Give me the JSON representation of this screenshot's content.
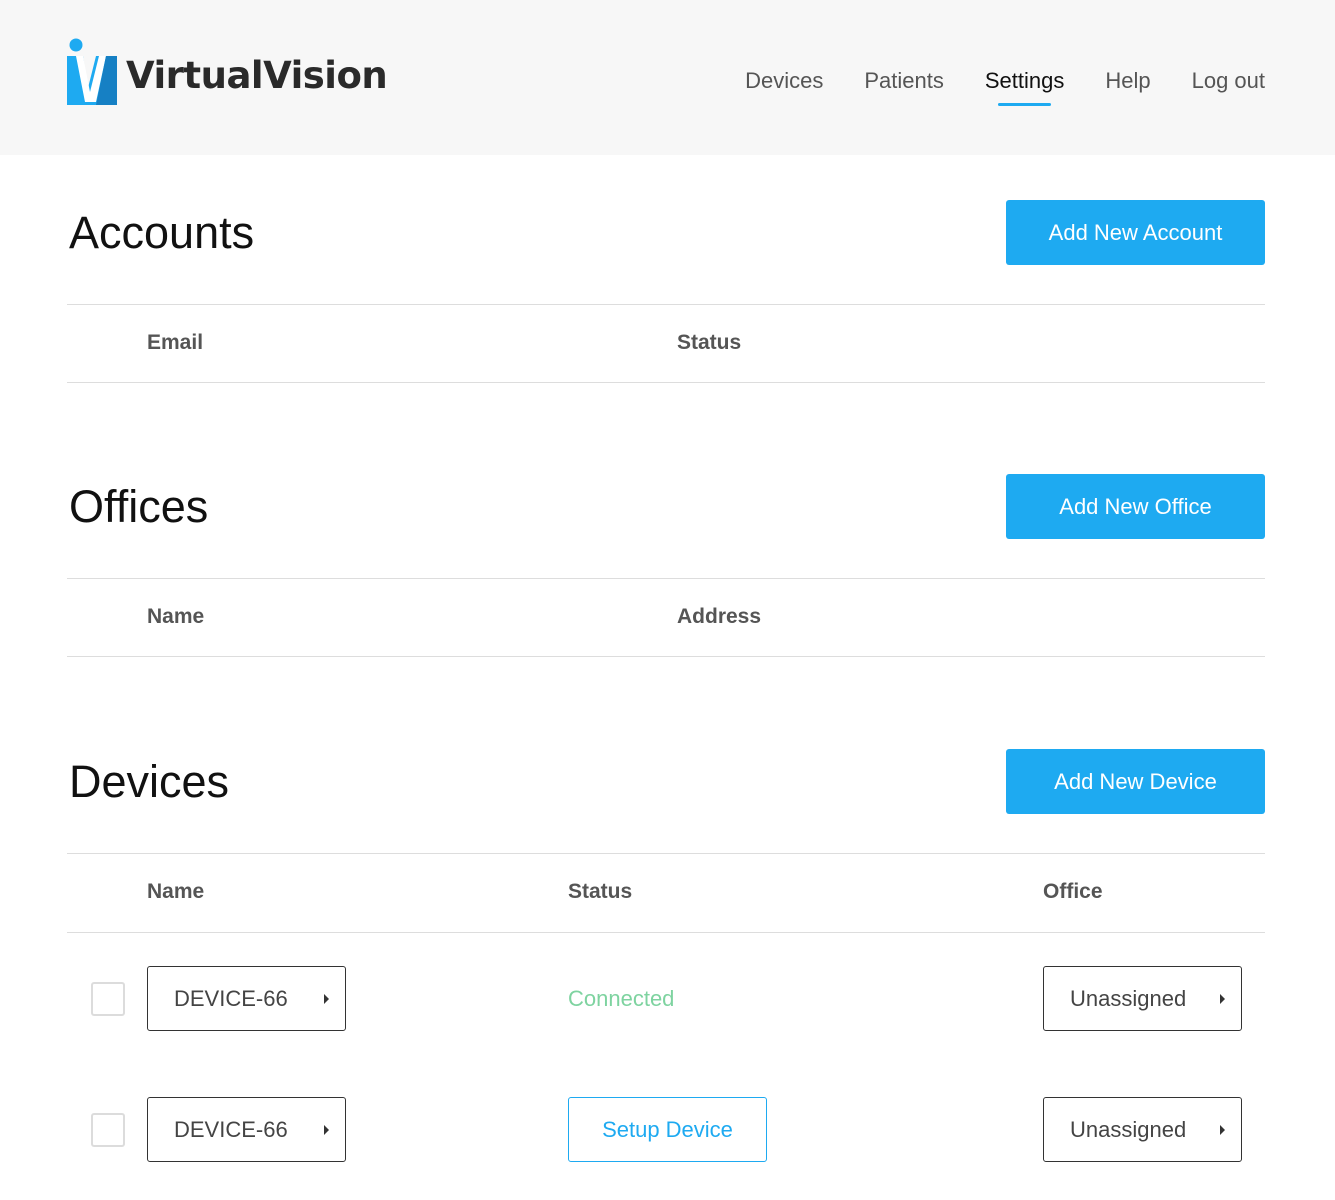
{
  "brand": {
    "name": "VirtualVision",
    "accent": "#1eaaf1"
  },
  "nav": [
    {
      "label": "Devices",
      "active": false
    },
    {
      "label": "Patients",
      "active": false
    },
    {
      "label": "Settings",
      "active": true
    },
    {
      "label": "Help",
      "active": false
    },
    {
      "label": "Log out",
      "active": false
    }
  ],
  "accounts": {
    "title": "Accounts",
    "add_label": "Add New Account",
    "columns": [
      "Email",
      "Status"
    ]
  },
  "offices": {
    "title": "Offices",
    "add_label": "Add New Office",
    "columns": [
      "Name",
      "Address"
    ]
  },
  "devices": {
    "title": "Devices",
    "add_label": "Add New Device",
    "columns": [
      "Name",
      "Status",
      "Office"
    ],
    "rows": [
      {
        "name": "DEVICE-66",
        "status": "Connected",
        "office": "Unassigned"
      },
      {
        "name": "DEVICE-66",
        "status_action": "Setup Device",
        "office": "Unassigned"
      }
    ]
  },
  "colors": {
    "connected": "#7ed3a0",
    "button": "#1eaaf1"
  }
}
